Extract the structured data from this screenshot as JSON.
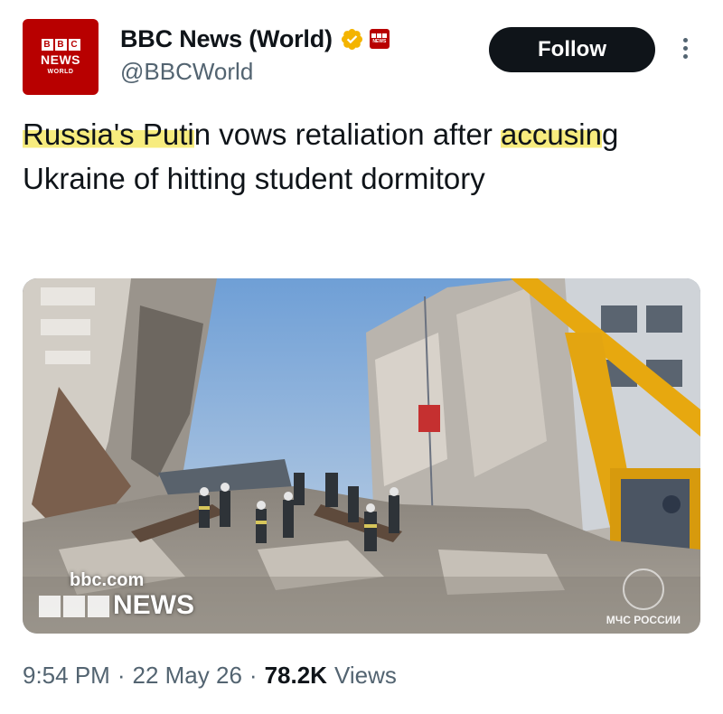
{
  "author": {
    "display_name": "BBC News (World)",
    "handle": "@BBCWorld",
    "avatar_blocks": [
      "B",
      "B",
      "C"
    ],
    "avatar_news": "NEWS",
    "avatar_world": "WORLD",
    "verified": true,
    "verified_color": "#f4b400",
    "brand_color": "#b80000"
  },
  "actions": {
    "follow_label": "Follow",
    "more_icon": "more-vertical-icon"
  },
  "tweet": {
    "text_highlight_1": "Russia's Puti",
    "text_part_1": "n vows retaliation after ",
    "text_highlight_2": "accusin",
    "text_part_2": "g Ukraine of hitting student dormitory",
    "highlight_color": "#f7ec7e"
  },
  "media": {
    "watermark_site": "bbc.com",
    "watermark_news": "NEWS",
    "watermark_agency": "МЧС РОССИИ"
  },
  "meta": {
    "time": "9:54 PM",
    "date": "22 May 26",
    "views_count": "78.2K",
    "views_label": "Views"
  }
}
